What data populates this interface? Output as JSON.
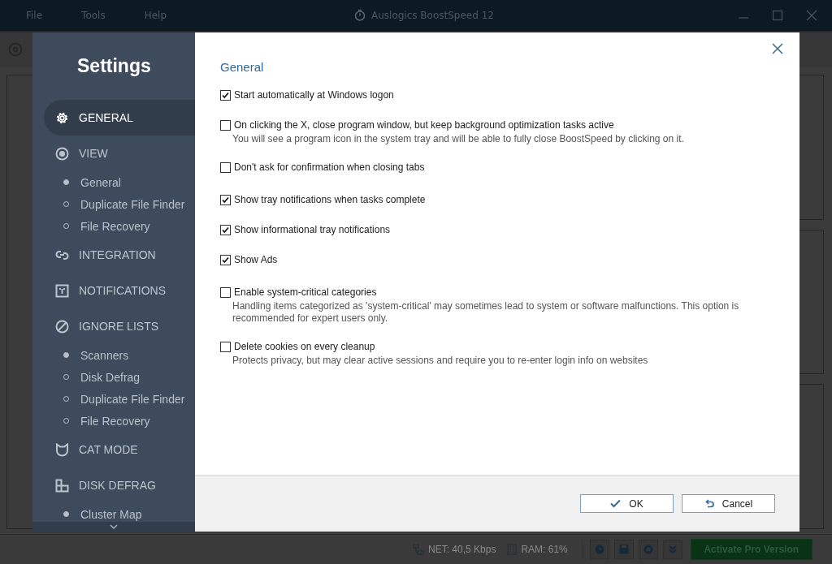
{
  "app": {
    "title": "Auslogics BoostSpeed 12",
    "menu": [
      "File",
      "Tools",
      "Help"
    ]
  },
  "settings": {
    "title": "Settings",
    "nav": [
      {
        "label": "GENERAL",
        "selected": true
      },
      {
        "label": "VIEW",
        "selected": false,
        "children": [
          {
            "label": "General",
            "selected": true
          },
          {
            "label": "Duplicate File Finder",
            "selected": false
          },
          {
            "label": "File Recovery",
            "selected": false
          }
        ]
      },
      {
        "label": "INTEGRATION",
        "selected": false
      },
      {
        "label": "NOTIFICATIONS",
        "selected": false
      },
      {
        "label": "IGNORE LISTS",
        "selected": false,
        "children": [
          {
            "label": "Scanners",
            "selected": true
          },
          {
            "label": "Disk Defrag",
            "selected": false
          },
          {
            "label": "Duplicate File Finder",
            "selected": false
          },
          {
            "label": "File Recovery",
            "selected": false
          }
        ]
      },
      {
        "label": "CAT MODE",
        "selected": false
      },
      {
        "label": "DISK DEFRAG",
        "selected": false,
        "children": [
          {
            "label": "Cluster Map",
            "selected": true
          }
        ]
      }
    ],
    "heading": "General",
    "groups": [
      [
        {
          "label": "Start automatically at Windows logon",
          "checked": true
        },
        {
          "label": "On clicking the X, close program window, but keep background optimization tasks active",
          "checked": false,
          "description": "You will see a program icon in the system tray and will be able to fully close BoostSpeed by clicking on it."
        },
        {
          "label": "Don't ask for confirmation when closing tabs",
          "checked": false
        }
      ],
      [
        {
          "label": "Show tray notifications when tasks complete",
          "checked": true
        },
        {
          "label": "Show informational tray notifications",
          "checked": true
        },
        {
          "label": "Show Ads",
          "checked": true
        }
      ],
      [
        {
          "label": "Enable system-critical categories",
          "checked": false,
          "description": "Handling items categorized as 'system-critical' may sometimes lead to system or software malfunctions. This option is recommended for expert users only."
        },
        {
          "label": "Delete cookies on every cleanup",
          "checked": false,
          "description": "Protects privacy, but may clear active sessions and require you to re-enter login info on websites"
        }
      ]
    ],
    "ok": "OK",
    "cancel": "Cancel"
  },
  "status_bar": {
    "net": "NET:  40,5 Kbps",
    "ram": "RAM:  61%",
    "activate": "Activate Pro Version"
  }
}
